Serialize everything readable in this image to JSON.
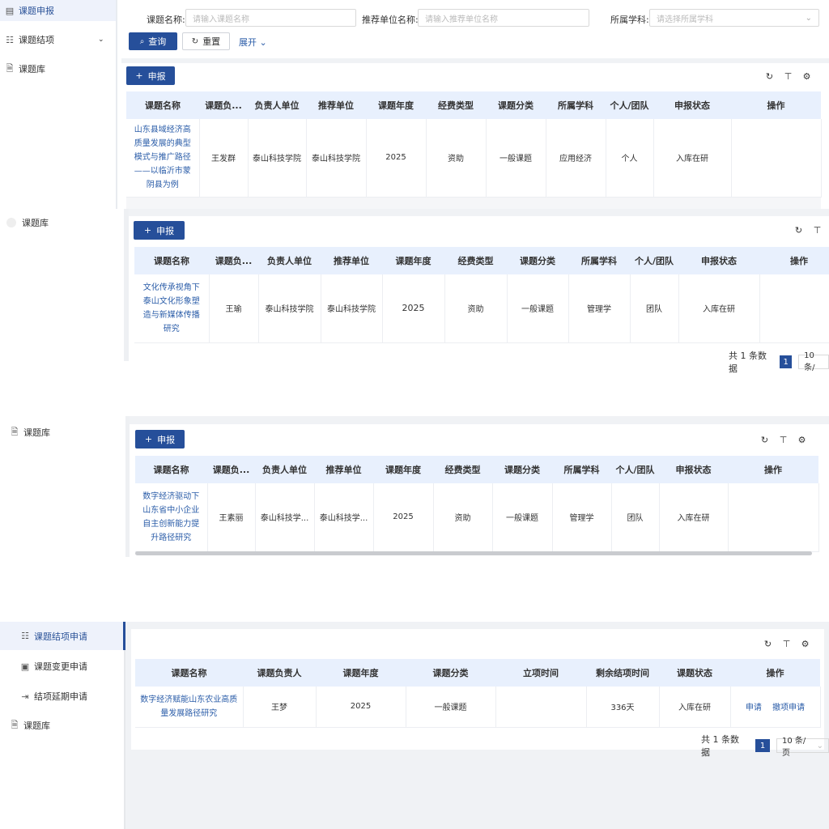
{
  "sidebar1": {
    "items": [
      {
        "label": "课题申报",
        "icon": "document-icon",
        "active": true
      },
      {
        "label": "课题结项",
        "icon": "checklist-icon"
      },
      {
        "label": "课题库",
        "icon": "file-icon"
      }
    ]
  },
  "search": {
    "name_label": "课题名称:",
    "name_placeholder": "请输入课题名称",
    "unit_label": "推荐单位名称:",
    "unit_placeholder": "请输入推荐单位名称",
    "subject_label": "所属学科:",
    "subject_placeholder": "请选择所属学科",
    "query_button": "查询",
    "reset_button": "重置",
    "expand_button": "展开"
  },
  "apply_button": "申报",
  "columns_full": [
    "课题名称",
    "课题负...",
    "负责人单位",
    "推荐单位",
    "课题年度",
    "经费类型",
    "课题分类",
    "所属学科",
    "个人/团队",
    "申报状态",
    "操作"
  ],
  "table1": {
    "rows": [
      {
        "name": "山东县域经济高质量发展的典型模式与推广路径——以临沂市蒙阴县为例",
        "leader": "王发群",
        "leader_unit": "泰山科技学院",
        "recommend_unit": "泰山科技学院",
        "year": "2025",
        "fund": "资助",
        "category": "一般课题",
        "subject": "应用经济",
        "type": "个人",
        "status": "入库在研",
        "action": ""
      }
    ]
  },
  "sidebar2": {
    "label": "课题库"
  },
  "table2": {
    "rows": [
      {
        "name": "文化传承视角下泰山文化形象塑造与新媒体传播研究",
        "leader": "王瑜",
        "leader_unit": "泰山科技学院",
        "recommend_unit": "泰山科技学院",
        "year": "2025",
        "fund": "资助",
        "category": "一般课题",
        "subject": "管理学",
        "type": "团队",
        "status": "入库在研",
        "action": ""
      }
    ],
    "pager": {
      "total": "共 1 条数据",
      "page": "1",
      "size": "10 条/"
    }
  },
  "sidebar3": {
    "label": "课题库"
  },
  "table3": {
    "rows": [
      {
        "name": "数字经济驱动下山东省中小企业自主创新能力提升路径研究",
        "leader": "王素丽",
        "leader_unit": "泰山科技学...",
        "recommend_unit": "泰山科技学...",
        "year": "2025",
        "fund": "资助",
        "category": "一般课题",
        "subject": "管理学",
        "type": "团队",
        "status": "入库在研",
        "action": ""
      }
    ]
  },
  "sidebar4": {
    "items": [
      {
        "label": "课题结项申请",
        "icon": "checklist-icon",
        "active": true
      },
      {
        "label": "课题变更申请",
        "icon": "edit-box-icon"
      },
      {
        "label": "结项延期申请",
        "icon": "extend-icon"
      },
      {
        "label": "课题库",
        "icon": "file-icon"
      }
    ]
  },
  "table4": {
    "columns": [
      "课题名称",
      "课题负责人",
      "课题年度",
      "课题分类",
      "立项时间",
      "剩余结项时间",
      "课题状态",
      "操作"
    ],
    "rows": [
      {
        "name": "数字经济赋能山东农业高质量发展路径研究",
        "leader": "王梦",
        "year": "2025",
        "category": "一般课题",
        "start": "",
        "remaining": "336天",
        "status": "入库在研",
        "action_apply": "申请",
        "action_withdraw": "撤项申请"
      }
    ],
    "pager": {
      "total": "共 1 条数据",
      "page": "1",
      "size": "10 条/页"
    }
  }
}
